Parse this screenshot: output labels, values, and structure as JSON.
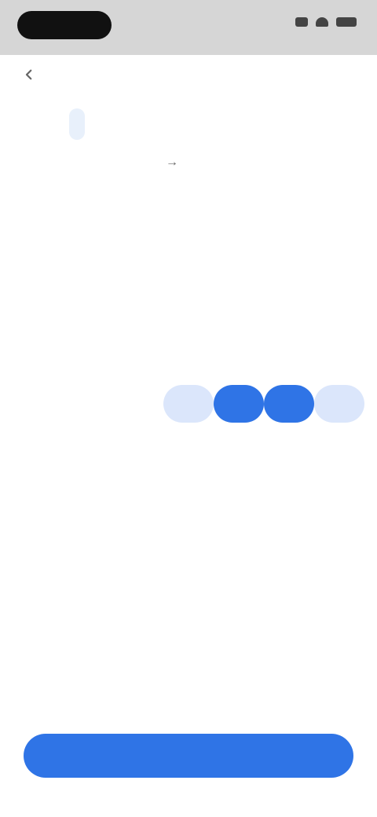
{
  "status_bar": {
    "time": "",
    "icons": [
      "signal-icon",
      "wifi-icon",
      "battery-icon"
    ]
  },
  "header": {
    "back_icon": "chevron-left-icon",
    "tabs": [
      {
        "label": "",
        "active": true
      },
      {
        "label": "",
        "active": false
      }
    ],
    "dates": {
      "start": "",
      "arrow": "→",
      "end": ""
    }
  },
  "calendar": {
    "accent": "#2f74e6",
    "range_tint": "#dbe6fb",
    "month1": {
      "title": "",
      "weekdays": [
        "",
        "",
        "",
        "",
        "",
        "",
        ""
      ],
      "days": [
        {
          "label": "",
          "state": "empty"
        },
        {
          "label": "",
          "state": "empty"
        },
        {
          "label": "",
          "state": "empty"
        },
        {
          "label": "",
          "state": "empty"
        },
        {
          "label": "",
          "state": "empty"
        },
        {
          "label": "",
          "state": "empty"
        },
        {
          "label": "",
          "state": "empty"
        },
        {
          "label": "",
          "state": "muted"
        },
        {
          "label": "",
          "state": "muted"
        },
        {
          "label": "",
          "state": "muted"
        },
        {
          "label": "",
          "state": "muted"
        },
        {
          "label": "",
          "state": "muted"
        },
        {
          "label": "",
          "state": "muted"
        },
        {
          "label": "",
          "state": "muted"
        },
        {
          "label": "",
          "state": "normal"
        },
        {
          "label": "",
          "state": "normal"
        },
        {
          "label": "",
          "state": "normal"
        },
        {
          "label": "",
          "state": "range"
        },
        {
          "label": "",
          "state": "selected"
        },
        {
          "label": "",
          "state": "selected"
        },
        {
          "label": "",
          "state": "range"
        },
        {
          "label": "",
          "state": "normal"
        },
        {
          "label": "",
          "state": "normal"
        },
        {
          "label": "",
          "state": "normal"
        },
        {
          "label": "",
          "state": "normal"
        },
        {
          "label": "",
          "state": "normal"
        },
        {
          "label": "",
          "state": "normal"
        },
        {
          "label": "",
          "state": "normal"
        },
        {
          "label": "",
          "state": "normal"
        },
        {
          "label": "",
          "state": "normal"
        },
        {
          "label": "",
          "state": "normal"
        },
        {
          "label": "",
          "state": "normal"
        },
        {
          "label": "",
          "state": "empty"
        },
        {
          "label": "",
          "state": "empty"
        },
        {
          "label": "",
          "state": "empty"
        }
      ]
    },
    "month2": {
      "title": "",
      "weekdays": [
        "",
        "",
        "",
        "",
        "",
        "",
        ""
      ]
    }
  },
  "footer": {
    "summary": "",
    "confirm_label": ""
  }
}
